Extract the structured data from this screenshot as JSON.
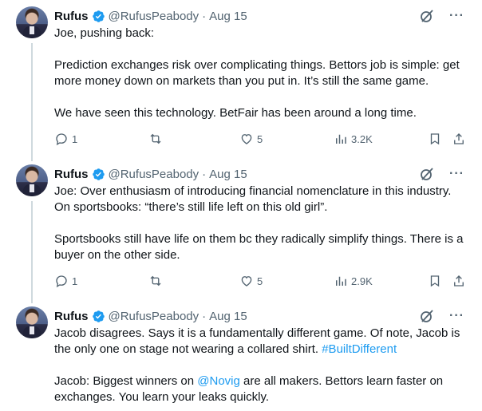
{
  "tweets": [
    {
      "name": "Rufus",
      "handle": "@RufusPeabody",
      "dot": "·",
      "date": "Aug 15",
      "text": "Joe, pushing back:\n\nPrediction exchanges risk over complicating things. Bettors job is simple: get more money down on markets than you put in. It’s still the same game.\n\nWe have seen this technology. BetFair has been around a long time.",
      "replies": "1",
      "likes": "5",
      "views": "3.2K"
    },
    {
      "name": "Rufus",
      "handle": "@RufusPeabody",
      "dot": "·",
      "date": "Aug 15",
      "text": "Joe: Over enthusiasm of introducing financial nomenclature in this industry. On sportsbooks: “there’s still life left on this old girl”.\n\nSportsbooks still have life on them bc they radically simplify things. There is a buyer on the other side.",
      "replies": "1",
      "likes": "5",
      "views": "2.9K"
    },
    {
      "name": "Rufus",
      "handle": "@RufusPeabody",
      "dot": "·",
      "date": "Aug 15",
      "text_part1": "Jacob disagrees. Says it is a fundamentally different game. Of note, Jacob is the only one on stage not wearing a collared shirt. ",
      "hashtag": "#BuiltDifferent",
      "text_part2": "\n\nJacob: Biggest winners on ",
      "mention": "@Novig",
      "text_part3": " are all makers. Bettors learn faster on exchanges. You learn your leaks quickly."
    }
  ],
  "icons": {
    "verified": "verified-badge-icon",
    "grok": "grok-icon",
    "more": "more-icon",
    "reply": "reply-icon",
    "retweet": "retweet-icon",
    "like": "like-icon",
    "views": "views-icon",
    "bookmark": "bookmark-icon",
    "share": "share-icon"
  },
  "colors": {
    "text": "#0f1419",
    "secondary": "#536471",
    "link": "#1d9bf0",
    "thread_line": "#cfd9de"
  }
}
